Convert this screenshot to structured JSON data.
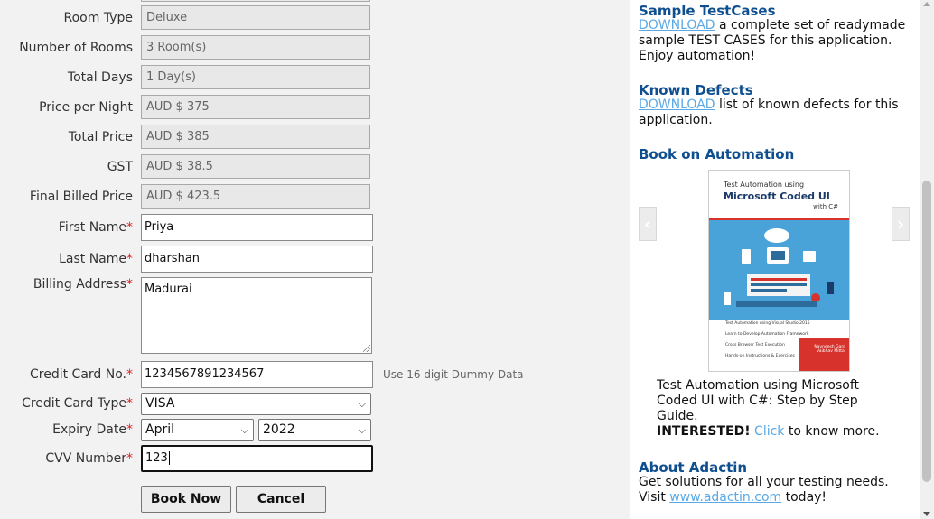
{
  "form": {
    "room_type": {
      "label": "Room Type",
      "value": "Deluxe"
    },
    "number_of_rooms": {
      "label": "Number of Rooms",
      "value": "3 Room(s)"
    },
    "total_days": {
      "label": "Total Days",
      "value": "1 Day(s)"
    },
    "price_per_night": {
      "label": "Price per Night",
      "value": "AUD $ 375"
    },
    "total_price": {
      "label": "Total Price",
      "value": "AUD $ 385"
    },
    "gst": {
      "label": "GST",
      "value": "AUD $ 38.5"
    },
    "final_billed_price": {
      "label": "Final Billed Price",
      "value": "AUD $ 423.5"
    },
    "first_name": {
      "label": "First Name",
      "value": "Priya"
    },
    "last_name": {
      "label": "Last Name",
      "value": "dharshan"
    },
    "billing_address": {
      "label": "Billing Address",
      "value": "Madurai"
    },
    "credit_card_no": {
      "label": "Credit Card No.",
      "value": "1234567891234567",
      "hint": "Use 16 digit Dummy Data"
    },
    "credit_card_type": {
      "label": "Credit Card Type",
      "value": "VISA"
    },
    "expiry_date": {
      "label": "Expiry Date",
      "month": "April",
      "year": "2022"
    },
    "cvv_number": {
      "label": "CVV Number",
      "value": "123"
    },
    "required_marker": "*",
    "book_now_label": "Book Now",
    "cancel_label": "Cancel"
  },
  "sidebar": {
    "sample_testcases": {
      "title": "Sample TestCases",
      "link": "DOWNLOAD",
      "text": " a complete set of readymade sample TEST CASES for this application. Enjoy automation!"
    },
    "known_defects": {
      "title": "Known Defects",
      "link": "DOWNLOAD",
      "text": " list of known defects for this application."
    },
    "book": {
      "title": "Book on Automation",
      "cover_line1": "Test Automation using",
      "cover_line2": "Microsoft Coded UI",
      "cover_line3": "with C#",
      "cover_items": [
        "Test Automation using Visual Studio 2015",
        "Learn to Develop Automation Framework",
        "Cross Browser Test Execution",
        "Hands-on Instructions & Exercises"
      ],
      "cover_authors": "Navneesh Garg\nVaibhav Mittal",
      "description": "Test Automation using Microsoft Coded UI with C#: Step by Step Guide.",
      "interested": "INTERESTED!",
      "click": "Click",
      "more": " to know more."
    },
    "about": {
      "title": "About Adactin",
      "line1": "Get solutions for all your testing needs.",
      "visit": "Visit ",
      "site": "www.adactin.com",
      "today": " today!"
    }
  },
  "colors": {
    "heading": "#0f4f8f",
    "link": "#5aa9e6",
    "required": "#e02020",
    "book_red": "#d8322c",
    "book_blue": "#4aa3d8"
  }
}
